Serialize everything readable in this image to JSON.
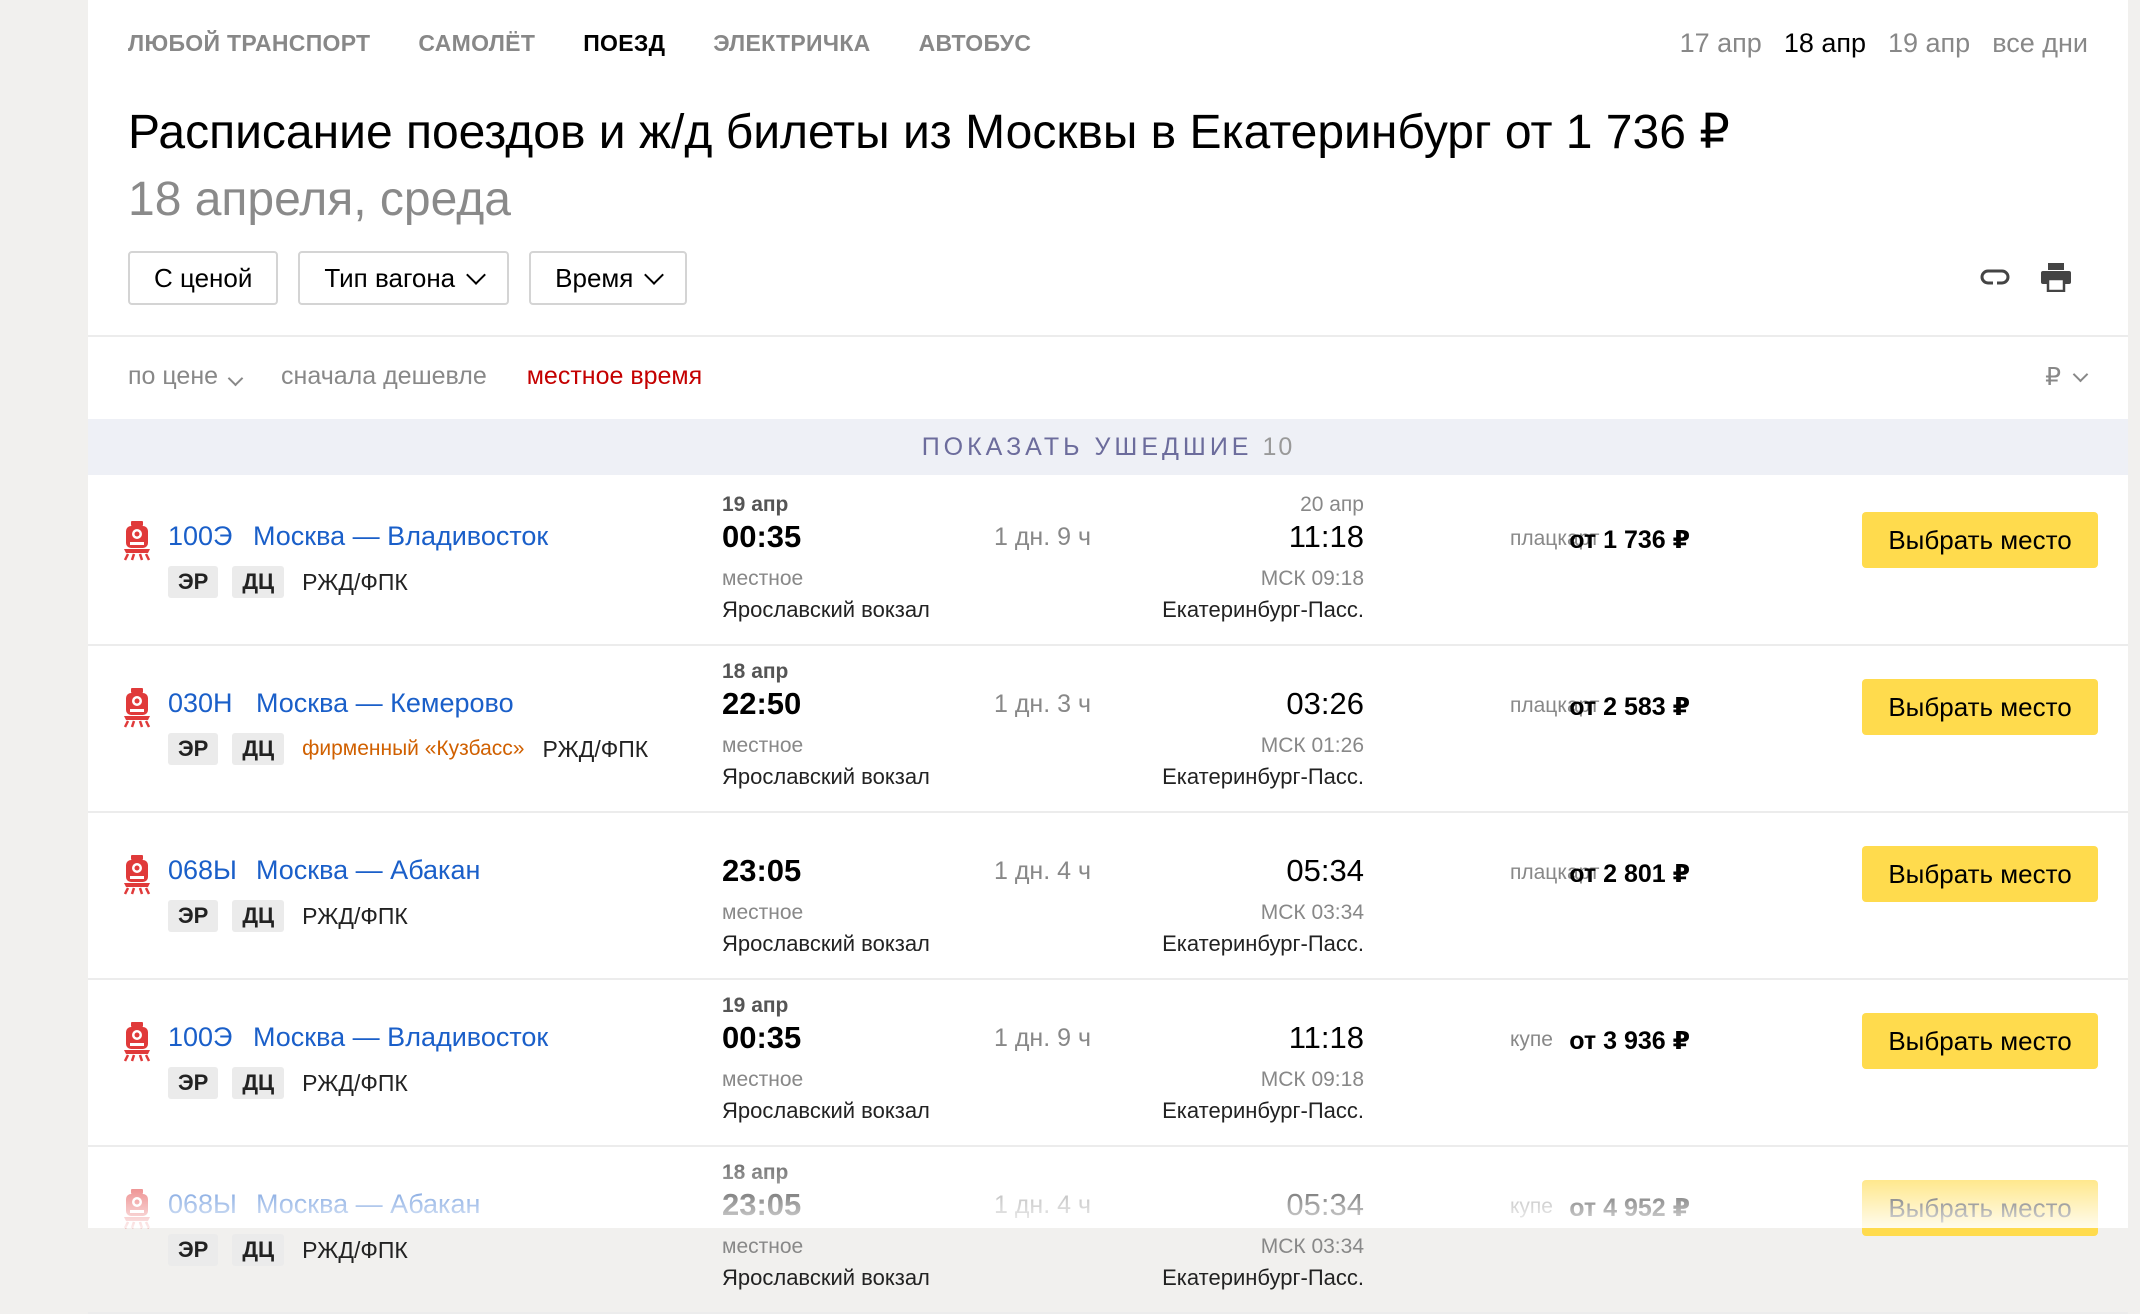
{
  "transport_tabs": [
    {
      "label": "ЛЮБОЙ ТРАНСПОРТ",
      "active": false
    },
    {
      "label": "САМОЛЁТ",
      "active": false
    },
    {
      "label": "ПОЕЗД",
      "active": true
    },
    {
      "label": "ЭЛЕКТРИЧКА",
      "active": false
    },
    {
      "label": "АВТОБУС",
      "active": false
    }
  ],
  "date_tabs": [
    {
      "label": "17 апр",
      "active": false
    },
    {
      "label": "18 апр",
      "active": true
    },
    {
      "label": "19 апр",
      "active": false
    },
    {
      "label": "все дни",
      "active": false
    }
  ],
  "header": {
    "title": "Расписание поездов и ж/д билеты из Москвы в Екатеринбург от 1 736 ₽",
    "subtitle": "18 апреля, среда"
  },
  "filters": {
    "with_price": "С ценой",
    "car_type": "Тип вагона",
    "time": "Время"
  },
  "sort": {
    "by": "по цене",
    "order": "сначала дешевле",
    "time_mode": "местное время",
    "currency": "₽"
  },
  "show_departed": {
    "label": "ПОКАЗАТЬ УШЕДШИЕ",
    "count": "10"
  },
  "colors": {
    "link": "#1a5fc9",
    "button": "#ffdb4d",
    "local_time": "#c40000",
    "train_icon": "#e03a3a"
  },
  "trains": [
    {
      "number": "100Э",
      "route": "Москва — Владивосток",
      "badges": [
        "ЭР",
        "ДЦ"
      ],
      "brand": "",
      "carrier": "РЖД/ФПК",
      "dep_date": "19 апр",
      "dep_time": "00:35",
      "dep_local": "местное",
      "dep_station": "Ярославский вокзал",
      "duration": "1 дн. 9 ч",
      "arr_date": "20 апр",
      "arr_time": "11:18",
      "arr_msk": "МСК 09:18",
      "arr_station": "Екатеринбург-Пасс.",
      "car_type": "плацкарт",
      "price": "от 1 736 ₽",
      "button": "Выбрать место"
    },
    {
      "number": "030Н",
      "route": "Москва — Кемерово",
      "badges": [
        "ЭР",
        "ДЦ"
      ],
      "brand": "фирменный «Кузбасс»",
      "carrier": "РЖД/ФПК",
      "dep_date": "18 апр",
      "dep_time": "22:50",
      "dep_local": "местное",
      "dep_station": "Ярославский вокзал",
      "duration": "1 дн. 3 ч",
      "arr_date": "",
      "arr_time": "03:26",
      "arr_msk": "МСК 01:26",
      "arr_station": "Екатеринбург-Пасс.",
      "car_type": "плацкарт",
      "price": "от 2 583 ₽",
      "button": "Выбрать место"
    },
    {
      "number": "068Ы",
      "route": "Москва — Абакан",
      "badges": [
        "ЭР",
        "ДЦ"
      ],
      "brand": "",
      "carrier": "РЖД/ФПК",
      "dep_date": "",
      "dep_time": "23:05",
      "dep_local": "местное",
      "dep_station": "Ярославский вокзал",
      "duration": "1 дн. 4 ч",
      "arr_date": "",
      "arr_time": "05:34",
      "arr_msk": "МСК 03:34",
      "arr_station": "Екатеринбург-Пасс.",
      "car_type": "плацкарт",
      "price": "от 2 801 ₽",
      "button": "Выбрать место"
    },
    {
      "number": "100Э",
      "route": "Москва — Владивосток",
      "badges": [
        "ЭР",
        "ДЦ"
      ],
      "brand": "",
      "carrier": "РЖД/ФПК",
      "dep_date": "19 апр",
      "dep_time": "00:35",
      "dep_local": "местное",
      "dep_station": "Ярославский вокзал",
      "duration": "1 дн. 9 ч",
      "arr_date": "",
      "arr_time": "11:18",
      "arr_msk": "МСК 09:18",
      "arr_station": "Екатеринбург-Пасс.",
      "car_type": "купе",
      "price": "от 3 936 ₽",
      "button": "Выбрать место"
    },
    {
      "number": "068Ы",
      "route": "Москва — Абакан",
      "badges": [
        "ЭР",
        "ДЦ"
      ],
      "brand": "",
      "carrier": "РЖД/ФПК",
      "dep_date": "18 апр",
      "dep_time": "23:05",
      "dep_local": "местное",
      "dep_station": "Ярославский вокзал",
      "duration": "1 дн. 4 ч",
      "arr_date": "",
      "arr_time": "05:34",
      "arr_msk": "МСК 03:34",
      "arr_station": "Екатеринбург-Пасс.",
      "car_type": "купе",
      "price": "от 4 952 ₽",
      "button": "Выбрать место"
    }
  ]
}
